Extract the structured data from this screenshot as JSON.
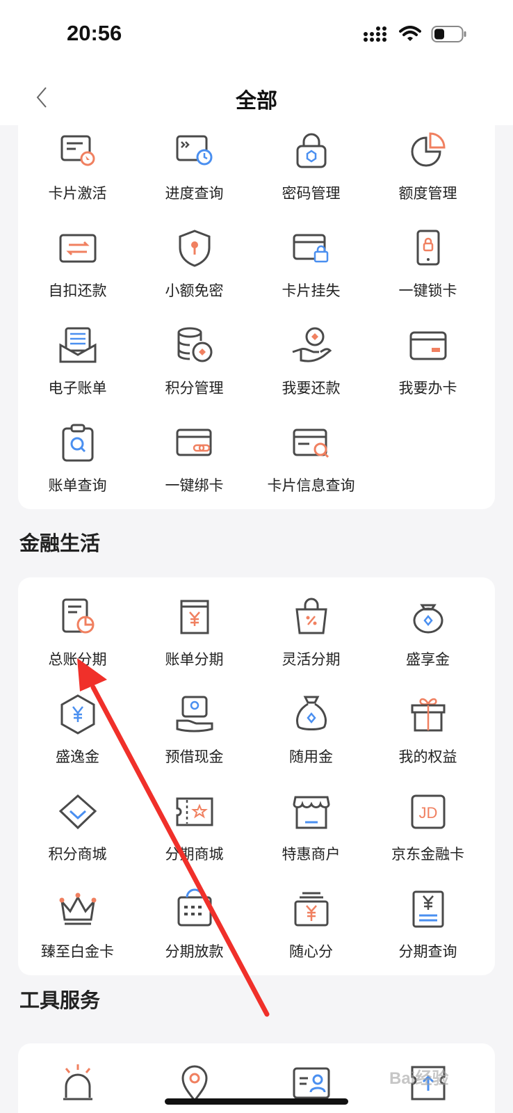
{
  "status_bar": {
    "time": "20:56"
  },
  "nav": {
    "title": "全部"
  },
  "colors": {
    "accent": "#f08060",
    "blue": "#4a8ff0",
    "stroke": "#4a4a4a",
    "arrow": "#f0302a"
  },
  "card_services": {
    "items": [
      {
        "label": "卡片激活",
        "icon": "card-activate-icon"
      },
      {
        "label": "进度查询",
        "icon": "progress-query-icon"
      },
      {
        "label": "密码管理",
        "icon": "password-lock-icon"
      },
      {
        "label": "额度管理",
        "icon": "pie-chart-icon"
      },
      {
        "label": "自扣还款",
        "icon": "auto-repay-icon"
      },
      {
        "label": "小额免密",
        "icon": "shield-key-icon"
      },
      {
        "label": "卡片挂失",
        "icon": "card-lock-icon"
      },
      {
        "label": "一键锁卡",
        "icon": "phone-lock-icon"
      },
      {
        "label": "电子账单",
        "icon": "e-bill-icon"
      },
      {
        "label": "积分管理",
        "icon": "points-coins-icon"
      },
      {
        "label": "我要还款",
        "icon": "hand-coin-icon"
      },
      {
        "label": "我要办卡",
        "icon": "credit-card-icon"
      },
      {
        "label": "账单查询",
        "icon": "clipboard-search-icon"
      },
      {
        "label": "一键绑卡",
        "icon": "card-link-icon"
      },
      {
        "label": "卡片信息查询",
        "icon": "card-search-icon"
      }
    ]
  },
  "section_finance": {
    "title": "金融生活"
  },
  "card_finance": {
    "items": [
      {
        "label": "总账分期",
        "icon": "document-chart-icon"
      },
      {
        "label": "账单分期",
        "icon": "bill-yuan-icon"
      },
      {
        "label": "灵活分期",
        "icon": "shopping-bag-percent-icon"
      },
      {
        "label": "盛享金",
        "icon": "money-bag-icon"
      },
      {
        "label": "盛逸金",
        "icon": "hexagon-yuan-icon"
      },
      {
        "label": "预借现金",
        "icon": "cash-advance-icon"
      },
      {
        "label": "随用金",
        "icon": "sack-icon"
      },
      {
        "label": "我的权益",
        "icon": "gift-box-icon"
      },
      {
        "label": "积分商城",
        "icon": "diamond-icon"
      },
      {
        "label": "分期商城",
        "icon": "ticket-star-icon"
      },
      {
        "label": "特惠商户",
        "icon": "storefront-icon"
      },
      {
        "label": "京东金融卡",
        "icon": "jd-card-icon",
        "icon_text": "JD"
      },
      {
        "label": "臻至白金卡",
        "icon": "crown-icon"
      },
      {
        "label": "分期放款",
        "icon": "calendar-icon"
      },
      {
        "label": "随心分",
        "icon": "yuan-box-icon"
      },
      {
        "label": "分期查询",
        "icon": "yuan-document-icon"
      }
    ]
  },
  "section_tools": {
    "title": "工具服务"
  },
  "card_tools": {
    "items": [
      {
        "icon": "alarm-light-icon"
      },
      {
        "icon": "location-pin-icon"
      },
      {
        "icon": "id-card-icon"
      },
      {
        "icon": "ticket-upload-icon"
      }
    ]
  },
  "watermark": {
    "text": "Bai经验"
  }
}
